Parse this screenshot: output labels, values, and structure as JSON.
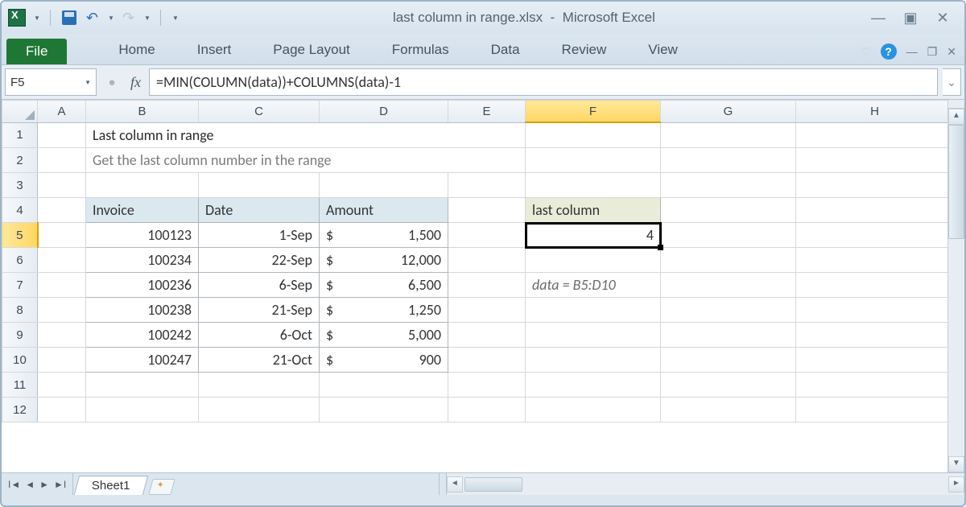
{
  "app": {
    "title_filename": "last column in range.xlsx",
    "title_app": "Microsoft Excel"
  },
  "ribbon": {
    "file": "File",
    "tabs": [
      "Home",
      "Insert",
      "Page Layout",
      "Formulas",
      "Data",
      "Review",
      "View"
    ]
  },
  "formula_bar": {
    "name_box": "F5",
    "fx": "fx",
    "formula": "=MIN(COLUMN(data))+COLUMNS(data)-1"
  },
  "columns": [
    "A",
    "B",
    "C",
    "D",
    "E",
    "F",
    "G",
    "H"
  ],
  "rows": [
    "1",
    "2",
    "3",
    "4",
    "5",
    "6",
    "7",
    "8",
    "9",
    "10",
    "11",
    "12"
  ],
  "content": {
    "title": "Last column in range",
    "subtitle": "Get the last column number in the range",
    "headers": {
      "b": "Invoice",
      "c": "Date",
      "d": "Amount"
    },
    "table": [
      {
        "invoice": "100123",
        "date": "1-Sep",
        "amount": "1,500"
      },
      {
        "invoice": "100234",
        "date": "22-Sep",
        "amount": "12,000"
      },
      {
        "invoice": "100236",
        "date": "6-Sep",
        "amount": "6,500"
      },
      {
        "invoice": "100238",
        "date": "21-Sep",
        "amount": "1,250"
      },
      {
        "invoice": "100242",
        "date": "6-Oct",
        "amount": "5,000"
      },
      {
        "invoice": "100247",
        "date": "21-Oct",
        "amount": "900"
      }
    ],
    "result_header": "last column",
    "result_value": "4",
    "note": "data = B5:D10",
    "currency": "$"
  },
  "tabs": {
    "sheet1": "Sheet1"
  },
  "active_cell": "F5",
  "colors": {
    "accent_green": "#1e7735",
    "header_fill": "#dbe8f0",
    "header2_fill": "#e9ecd8",
    "col_highlight": "#ffd662"
  }
}
